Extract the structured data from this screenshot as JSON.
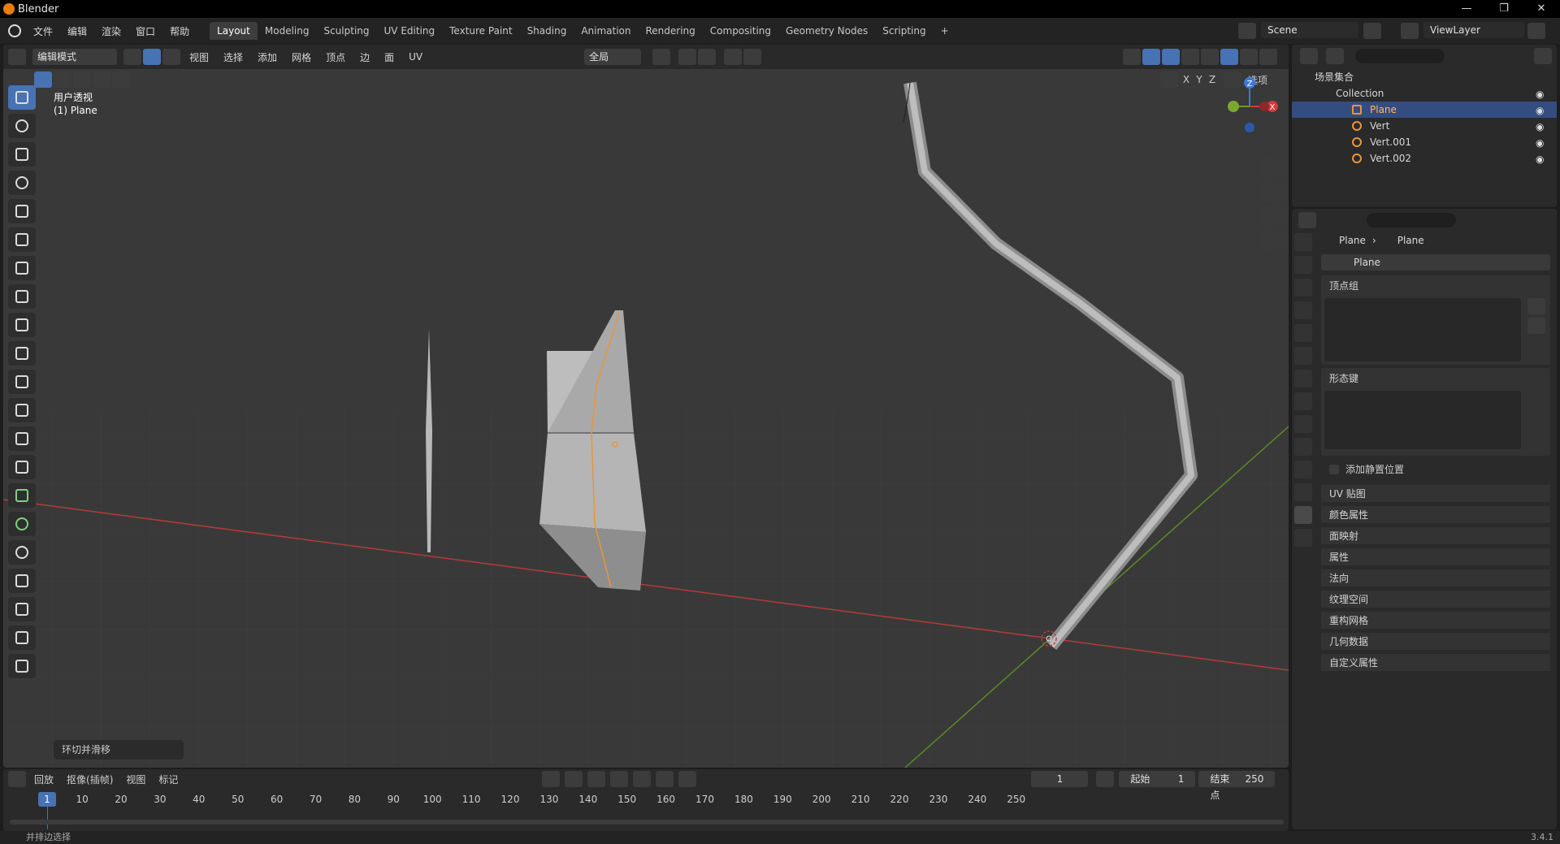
{
  "window": {
    "title": "Blender",
    "controls": [
      "—",
      "❐",
      "✕"
    ]
  },
  "menu": [
    "文件",
    "编辑",
    "渲染",
    "窗口",
    "帮助"
  ],
  "workspaces": [
    "Layout",
    "Modeling",
    "Sculpting",
    "UV Editing",
    "Texture Paint",
    "Shading",
    "Animation",
    "Rendering",
    "Compositing",
    "Geometry Nodes",
    "Scripting",
    "+"
  ],
  "active_workspace": "Layout",
  "scene": {
    "name": "Scene"
  },
  "viewlayer": {
    "name": "ViewLayer"
  },
  "viewport": {
    "mode": "编辑模式",
    "menus": [
      "视图",
      "选择",
      "添加",
      "网格",
      "顶点",
      "边",
      "面",
      "UV"
    ],
    "transform_orientation": "全局",
    "options_label": "选项",
    "axis_labels": [
      "X",
      "Y",
      "Z"
    ],
    "view_name": "用户透视",
    "object_label": "(1) Plane",
    "last_operator": "环切并滑移",
    "gizmo_labels": {
      "z": "Z",
      "x": "X"
    },
    "colors": {
      "bg": "#393939",
      "x_axis": "#c33b3b",
      "y_axis": "#6a9a2a",
      "selected_edge": "#e8963a"
    }
  },
  "outliner": {
    "root": "场景集合",
    "collection": "Collection",
    "items": [
      {
        "name": "Plane",
        "selected": true
      },
      {
        "name": "Vert",
        "selected": false
      },
      {
        "name": "Vert.001",
        "selected": false
      },
      {
        "name": "Vert.002",
        "selected": false
      }
    ]
  },
  "properties": {
    "breadcrumb": [
      "Plane",
      "Plane"
    ],
    "data_name": "Plane",
    "vertex_groups": "顶点组",
    "shape_keys": "形态键",
    "add_rest_position": "添加静置位置",
    "collapsed_panels": [
      "UV 贴图",
      "颜色属性",
      "面映射",
      "属性",
      "法向",
      "纹理空间",
      "重构网格",
      "几何数据",
      "自定义属性"
    ]
  },
  "timeline": {
    "menus": [
      "回放",
      "抠像(插帧)",
      "视图",
      "标记"
    ],
    "current_frame": "1",
    "start_label": "起始",
    "start": "1",
    "end_label": "结束点",
    "end": "250",
    "ticks": [
      "10",
      "20",
      "30",
      "40",
      "50",
      "60",
      "70",
      "80",
      "90",
      "100",
      "110",
      "120",
      "130",
      "140",
      "150",
      "160",
      "170",
      "180",
      "190",
      "200",
      "210",
      "220",
      "230",
      "240",
      "250"
    ],
    "marker_frame": "1"
  },
  "status": {
    "left": "并排边选择",
    "version": "3.4.1"
  }
}
